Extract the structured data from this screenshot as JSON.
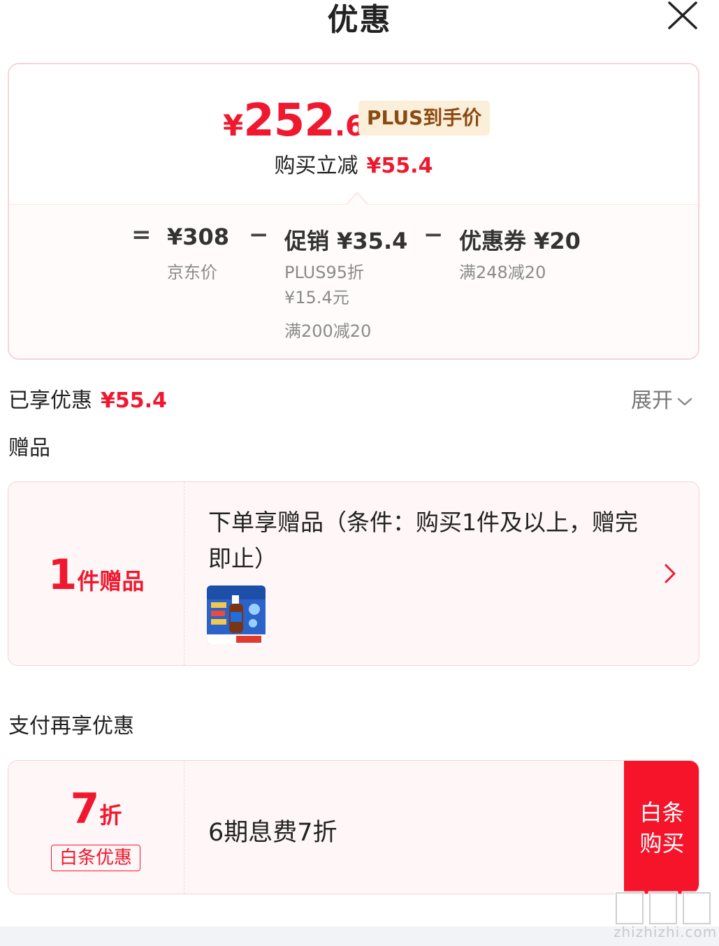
{
  "header": {
    "title": "优惠"
  },
  "price": {
    "yen": "¥",
    "integer": "252",
    "decimal": ".6",
    "badge": "PLUS到手价",
    "reduce_label": "购买立减",
    "reduce_value": "¥55.4"
  },
  "formula": {
    "equals": "=",
    "minus": "−",
    "jd_price": {
      "value": "¥308",
      "label": "京东价"
    },
    "promotion": {
      "value": "促销 ¥35.4",
      "details": [
        "PLUS95折",
        "¥15.4元",
        "满200减20"
      ]
    },
    "coupon": {
      "value": "优惠券 ¥20",
      "details": [
        "满248减20"
      ]
    }
  },
  "enjoyed": {
    "label": "已享优惠",
    "value": "¥55.4",
    "expand_label": "展开"
  },
  "gift": {
    "section_title": "赠品",
    "count": "1",
    "unit": "件赠品",
    "description": "下单享赠品（条件：购买1件及以上，赠完即止）"
  },
  "payment": {
    "section_title": "支付再享优惠",
    "discount": "7",
    "unit": "折",
    "tag": "白条优惠",
    "description": "6期息费7折",
    "button_line1": "白条",
    "button_line2": "购买"
  },
  "watermark": {
    "text": "zhizhizhi.com"
  },
  "colors": {
    "accent_red": "#f0182e",
    "badge_bg": "#fcefd9",
    "badge_text": "#8a4b12",
    "card_bg": "#fff7f7"
  },
  "icons": {
    "close": "close-icon",
    "expand": "chevron-down-icon",
    "gift_arrow": "chevron-right-icon"
  }
}
